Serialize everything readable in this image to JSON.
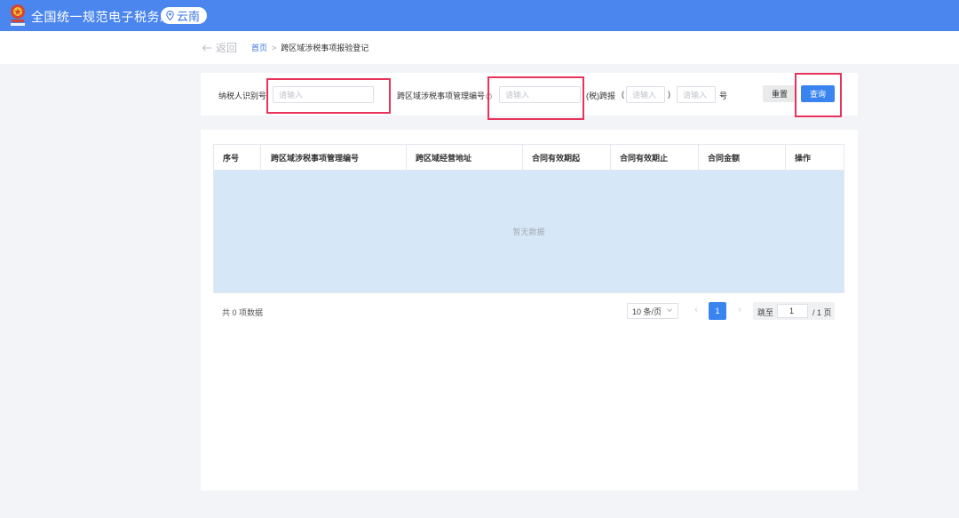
{
  "header": {
    "title": "全国统一规范电子税务局",
    "region": "云南",
    "brand_color": "#4a86ee",
    "emblem_icon": "tax-emblem-icon",
    "pin_icon": "location-pin-icon"
  },
  "breadcrumb": {
    "back_label": "返回",
    "home_label": "首页",
    "separator": ">",
    "current": "跨区域涉税事项报验登记"
  },
  "filters": {
    "taxpayer_id_label": "纳税人识别号",
    "taxpayer_id_placeholder": "请输入",
    "taxpayer_id_value": "",
    "matter_no_label": "跨区域涉税事项管理编号",
    "matter_no_placeholder": "请输入",
    "matter_no_value": "",
    "region_prefix": "(税)跨报",
    "region_open": "(",
    "region_code_placeholder": "请输入",
    "region_close": ")",
    "serial_placeholder": "请输入",
    "serial_suffix": "号",
    "reset_label": "重置",
    "query_label": "查询",
    "highlight_color": "#e8335a"
  },
  "table": {
    "columns": [
      "序号",
      "跨区域涉税事项管理编号",
      "跨区域经营地址",
      "合同有效期起",
      "合同有效期止",
      "合同金额",
      "操作"
    ],
    "rows": [],
    "empty_text": "暂无数据"
  },
  "pagination": {
    "total_text": "共 0 项数据",
    "page_size": "10 条/页",
    "prev": "‹",
    "current_page": "1",
    "next": "›",
    "jump_label": "跳至",
    "jump_value": "1",
    "page_total": "/ 1 页"
  }
}
